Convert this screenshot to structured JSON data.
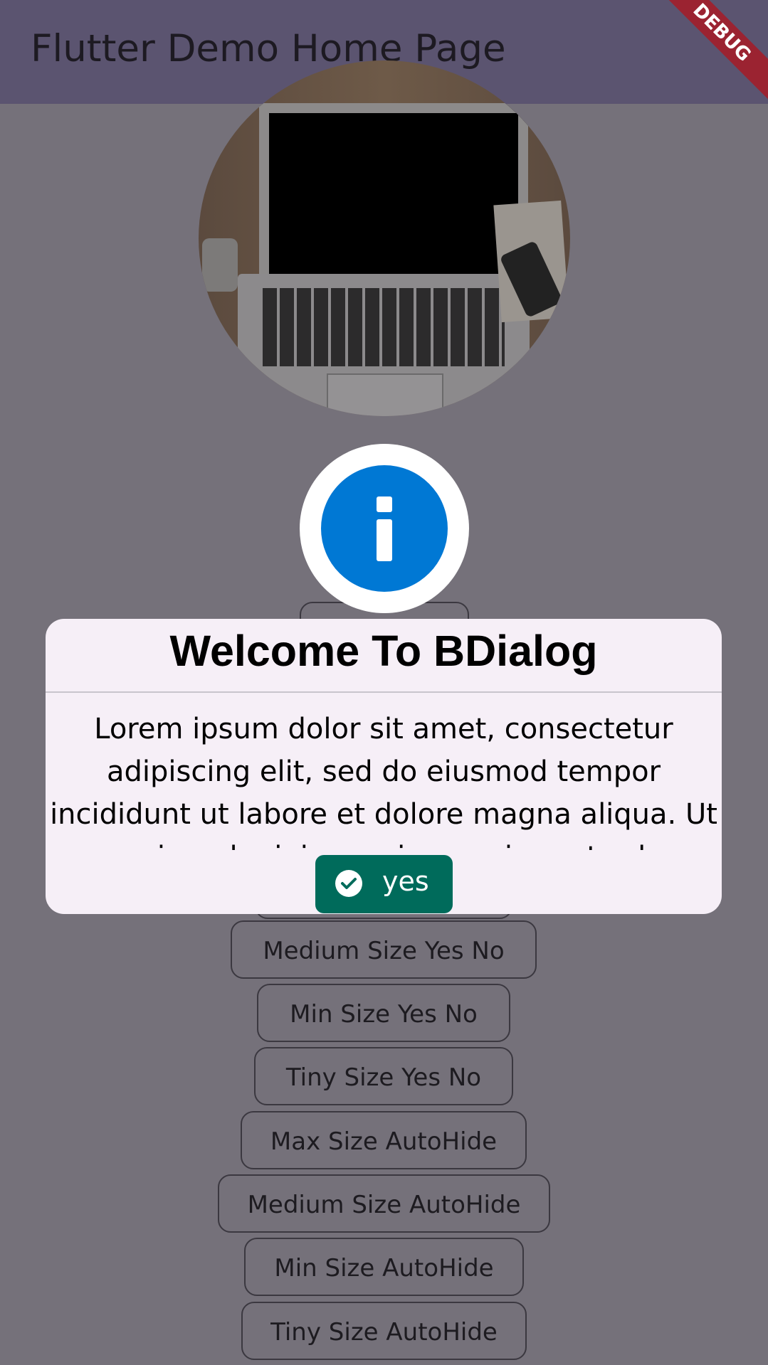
{
  "appbar": {
    "title": "Flutter Demo Home Page",
    "debug_label": "DEBUG"
  },
  "buttons": {
    "medium_yes_no": "Medium Size Yes No",
    "min_yes_no": "Min Size Yes No",
    "tiny_yes_no": "Tiny Size Yes No",
    "max_autohide": "Max Size AutoHide",
    "medium_autohide": "Medium Size AutoHide",
    "min_autohide": "Min Size AutoHide",
    "tiny_autohide": "Tiny Size AutoHide"
  },
  "dialog": {
    "title": "Welcome To BDialog",
    "body": "Lorem ipsum dolor sit amet, consectetur adipiscing elit, sed do eiusmod tempor incididunt ut labore et dolore magna aliqua. Ut enim ad minim veniam, quis nostrud exercitation ullamco",
    "yes_label": "yes",
    "icon": "info-icon",
    "accent_color": "#0078d4",
    "yes_color": "#006b5b"
  }
}
